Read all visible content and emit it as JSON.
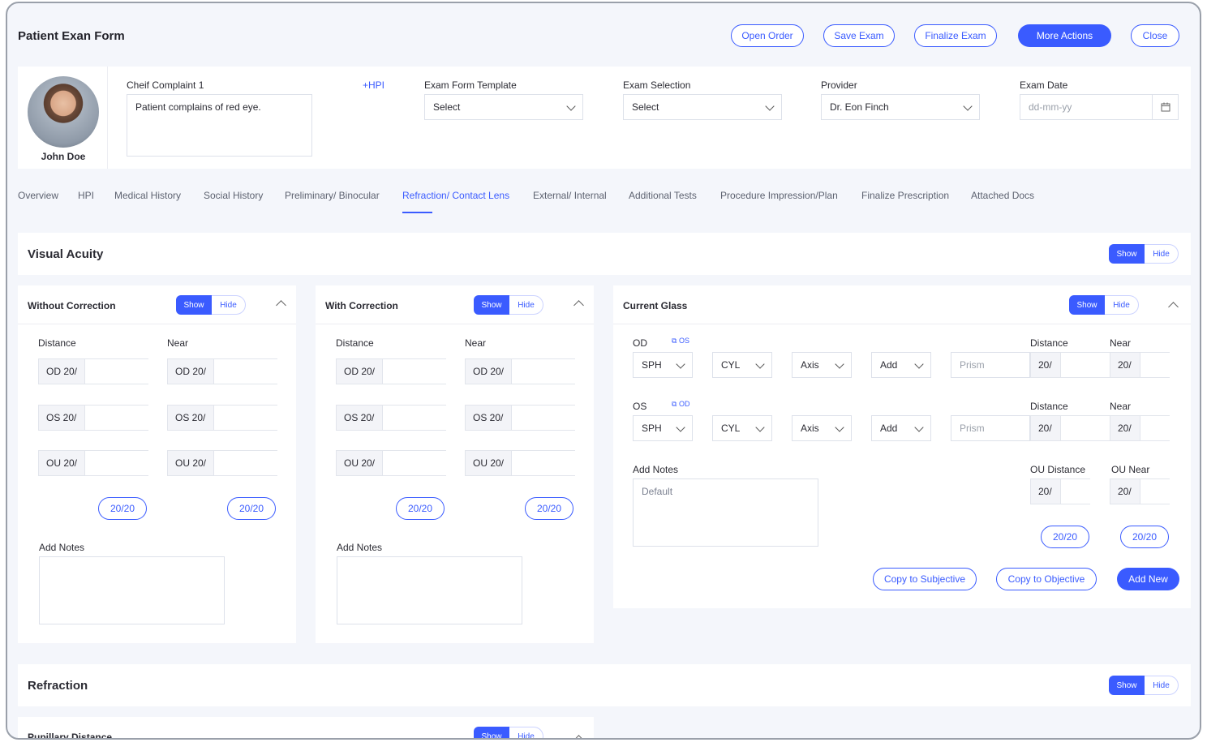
{
  "header": {
    "title": "Patient Exan Form",
    "buttons": [
      "Open Order",
      "Save Exam",
      "Finalize Exam",
      "More Actions",
      "Close"
    ]
  },
  "patient": {
    "name": "John Doe",
    "complaint_label": "Cheif Complaint 1",
    "hpi_link": "+HPI",
    "complaint_text": "Patient complains of red eye.",
    "template_label": "Exam Form Template",
    "template_value": "Select",
    "selection_label": "Exam Selection",
    "selection_value": "Select",
    "provider_label": "Provider",
    "provider_value": "Dr. Eon Finch",
    "date_label": "Exam Date",
    "date_placeholder": "dd-mm-yy"
  },
  "tabs": [
    "Overview",
    "HPI",
    "Medical History",
    "Social History",
    "Preliminary/ Binocular",
    "Refraction/ Contact Lens",
    "External/ Internal",
    "Additional Tests",
    "Procedure Impression/Plan",
    "Finalize Prescription",
    "Attached Docs"
  ],
  "active_tab": "Refraction/ Contact Lens",
  "visual_acuity": {
    "title": "Visual Acuity",
    "show": "Show",
    "hide": "Hide",
    "without_correction": {
      "title": "Without Correction",
      "distance": "Distance",
      "near": "Near",
      "rows": [
        "OD 20/",
        "OS 20/",
        "OU 20/"
      ],
      "pill": "20/20",
      "notes_label": "Add Notes"
    },
    "with_correction": {
      "title": "With Correction",
      "distance": "Distance",
      "near": "Near",
      "rows": [
        "OD 20/",
        "OS 20/",
        "OU 20/"
      ],
      "pill": "20/20",
      "notes_label": "Add Notes"
    },
    "current_glass": {
      "title": "Current Glass",
      "od_label": "OD",
      "os_label": "OS",
      "copy_os": "OS",
      "copy_od": "OD",
      "selects": [
        "SPH",
        "CYL",
        "Axis",
        "Add"
      ],
      "prism": "Prism",
      "distance": "Distance",
      "near": "Near",
      "twenty": "20/",
      "notes_label": "Add Notes",
      "notes_placeholder": "Default",
      "ou_distance": "OU Distance",
      "ou_near": "OU Near",
      "pill": "20/20",
      "copy_subjective": "Copy to Subjective",
      "copy_objective": "Copy to Objective",
      "add_new": "Add New"
    }
  },
  "refraction": {
    "title": "Refraction",
    "pupillary": "Pupillary Distance",
    "show": "Show",
    "hide": "Hide"
  }
}
